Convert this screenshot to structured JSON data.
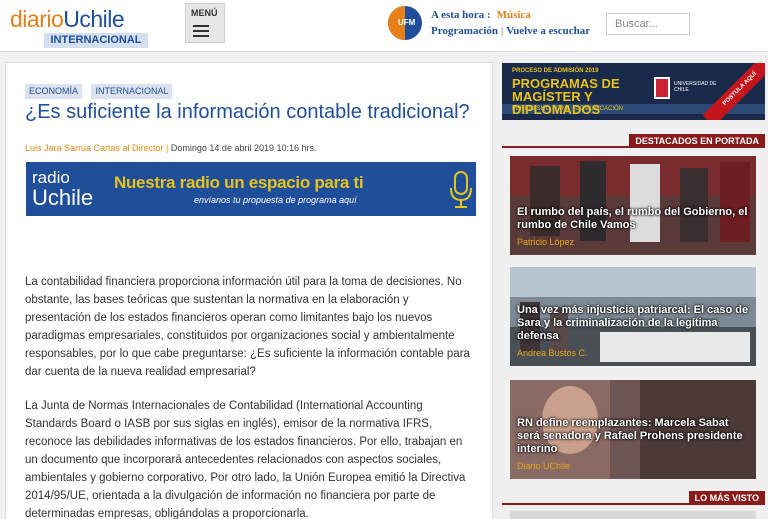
{
  "header": {
    "logo_diario": "diario",
    "logo_uchile": "Uchile",
    "logo_sub": "INTERNACIONAL",
    "menu_label": "MENÚ",
    "radio_icon_text": "UFM",
    "now_label": "A esta hora :",
    "now_value": "Música",
    "programacion": "Programación",
    "separator": "|",
    "vuelve": "Vuelve a escuchar",
    "search_placeholder": "Buscar..."
  },
  "article": {
    "tags": [
      "ECONOMÍA",
      "INTERNACIONAL"
    ],
    "title": "¿Es suficiente la información contable tradicional?",
    "author": "Luis Jara Sarrúa Cartas al Director |",
    "date": "Domingo 14 de abril 2019 10:16 hrs.",
    "banner": {
      "logo_top": "radio",
      "logo_bottom": "Uchile",
      "headline": "Nuestra radio un espacio para ti",
      "subline": "envíanos tu propuesta de programa aquí"
    },
    "paragraphs": [
      "La contabilidad financiera proporciona información útil para la toma de decisiones. No obstante, las bases teóricas que sustentan la normativa en la elaboración y presentación de los estados financieros operan como limitantes bajo los nuevos paradigmas empresariales, constituidos por organizaciones social y ambientalmente responsables, por lo que cabe preguntarse: ¿Es suficiente la información contable para dar cuenta de la nueva realidad empresarial?",
      "La Junta de Normas Internacionales de Contabilidad (International Accounting Standards Board o IASB por sus siglas en inglés), emisor de la normativa IFRS, reconoce las debilidades informativas de los estados financieros. Por ello, trabajan en un documento que incorporará antecedentes relacionados con aspectos sociales, ambientales y gobierno corporativo. Por otro lado, la Unión Europea emitió la Directiva 2014/95/UE, orientada a la divulgación de información no financiera por parte de determinadas empresas, obligándolas a proporcionarla."
    ]
  },
  "sidebar": {
    "promo": {
      "line1": "PROCESO DE ADMISIÓN 2019",
      "line2": "PROGRAMAS DE MAGÍSTER Y DIPLOMADOS",
      "line3": "PERIODISMO · CINE · COMUNICACIÓN",
      "univ": "UNIVERSIDAD DE CHILE",
      "corner": "POSTULA AQUÍ"
    },
    "destacados_label": "DESTACADOS EN PORTADA",
    "cards": [
      {
        "title": "El rumbo del país, el rumbo del Gobierno, el rumbo de Chile Vamos",
        "author": "Patricio López"
      },
      {
        "title": "Una vez más injusticia patriarcal: El caso de Sara y la criminalización de la legítima defensa",
        "author": "Andrea Bustos C."
      },
      {
        "title": "RN define reemplazantes: Marcela Sabat será senadora y Rafael Prohens presidente interino",
        "author": "Diario UChile"
      }
    ],
    "mas_visto_label": "LO MÁS VISTO"
  }
}
